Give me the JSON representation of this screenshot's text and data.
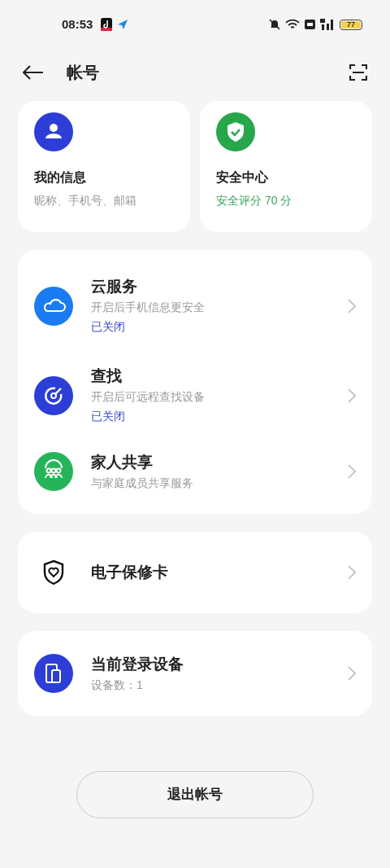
{
  "status_bar": {
    "time": "08:53",
    "battery": "77"
  },
  "header": {
    "title": "帐号"
  },
  "tiles": [
    {
      "title": "我的信息",
      "subtitle": "昵称、手机号、邮箱",
      "kind": "plain"
    },
    {
      "title": "安全中心",
      "subtitle": "安全评分 70 分",
      "kind": "score"
    }
  ],
  "groups": [
    {
      "items": [
        {
          "title": "云服务",
          "subtitle": "开启后手机信息更安全",
          "status": "已关闭"
        },
        {
          "title": "查找",
          "subtitle": "开启后可远程查找设备",
          "status": "已关闭"
        },
        {
          "title": "家人共享",
          "subtitle": "与家庭成员共享服务"
        }
      ]
    },
    {
      "items": [
        {
          "title": "电子保修卡"
        }
      ]
    },
    {
      "items": [
        {
          "title": "当前登录设备",
          "subtitle": "设备数：1"
        }
      ]
    }
  ],
  "logout_button": "退出帐号"
}
